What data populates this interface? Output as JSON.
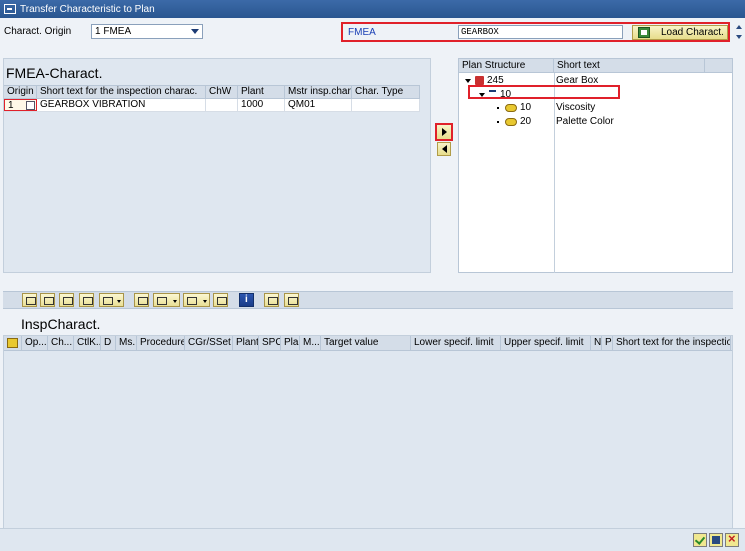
{
  "window": {
    "title": "Transfer Characteristic to Plan"
  },
  "origin": {
    "label": "Charact. Origin",
    "value": "1 FMEA"
  },
  "fmea": {
    "label": "FMEA",
    "value": "GEARBOX",
    "load_button": "Load Charact."
  },
  "fmea_panel": {
    "title": "FMEA-Charact.",
    "columns": [
      "Origin",
      "Short text for the inspection charac.",
      "ChW",
      "Plant",
      "Mstr insp.char.",
      "Char. Type"
    ],
    "rows": [
      {
        "origin": "1",
        "short_text": "GEARBOX VIBRATION",
        "chw": "",
        "plant": "1000",
        "mstr": "QM01",
        "type": ""
      }
    ]
  },
  "tree": {
    "columns": [
      "Plan Structure",
      "Short text"
    ],
    "nodes": [
      {
        "id": "245",
        "short": "Gear Box",
        "icon": "plan-icon"
      },
      {
        "id": "10",
        "short": "",
        "icon": "operation-icon"
      },
      {
        "id": "10",
        "short": "Viscosity",
        "icon": "characteristic-icon"
      },
      {
        "id": "20",
        "short": "Palette Color",
        "icon": "characteristic-icon"
      }
    ]
  },
  "insp_panel": {
    "title": "InspCharact.",
    "columns": [
      "Op...",
      "Ch...",
      "CtlK...",
      "D",
      "Ms...",
      "Procedure",
      "CGr/SSet",
      "Plant",
      "SPC",
      "Plan",
      "M...",
      "Target value",
      "Lower specif. limit",
      "Upper specif. limit",
      "N",
      "P",
      "Short text for the inspection"
    ]
  },
  "toolbar_icons": [
    "detail-icon",
    "filter-icon",
    "find-icon",
    "find-next-icon",
    "set-filter-icon",
    "print-preview-icon",
    "export-icon",
    "layout-icon",
    "grid-icon",
    "info-icon",
    "insert-icon",
    "delete-icon"
  ],
  "bottom_icons": [
    "confirm-icon",
    "save-icon",
    "cancel-icon"
  ]
}
